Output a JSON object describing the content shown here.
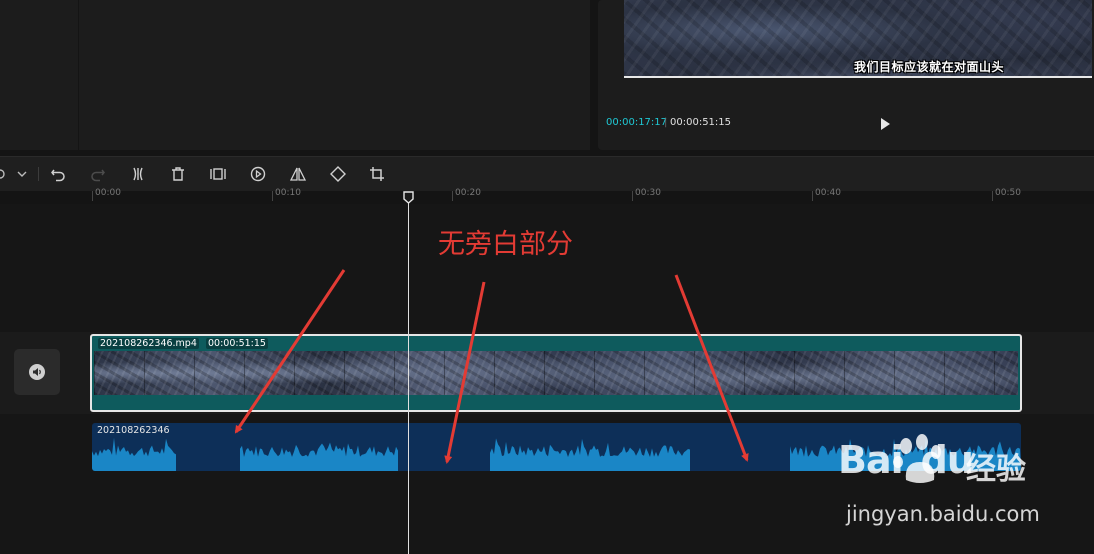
{
  "player": {
    "subtitle": "我们目标应该就在对面山头",
    "current_time": "00:00:17:17",
    "total_time": "00:00:51:15"
  },
  "toolbar": {
    "icons": [
      "undo-icon",
      "redo-icon",
      "split-icon",
      "delete-icon",
      "freeze-icon",
      "reverse-icon",
      "mirror-icon",
      "rotate-icon",
      "crop-icon"
    ]
  },
  "ruler": {
    "ticks": [
      "00:00",
      "00:10",
      "00:20",
      "00:30",
      "00:40",
      "00:50"
    ]
  },
  "timeline": {
    "playhead_time": "00:00:17:17"
  },
  "video_clip": {
    "name": "202108262346.mp4",
    "duration": "00:00:51:15"
  },
  "audio_clip": {
    "name": "202108262346"
  },
  "annotation": {
    "text": "无旁白部分"
  },
  "watermark": {
    "logo_text": "Bai du",
    "cn_text": "经验",
    "url": "jingyan.baidu.com"
  },
  "colors": {
    "accent_teal": "#1fc8d4",
    "annotation_red": "#e33b34",
    "video_clip": "#0e5b5d",
    "audio_clip": "#0d2f58",
    "waveform": "#1a86c6"
  }
}
